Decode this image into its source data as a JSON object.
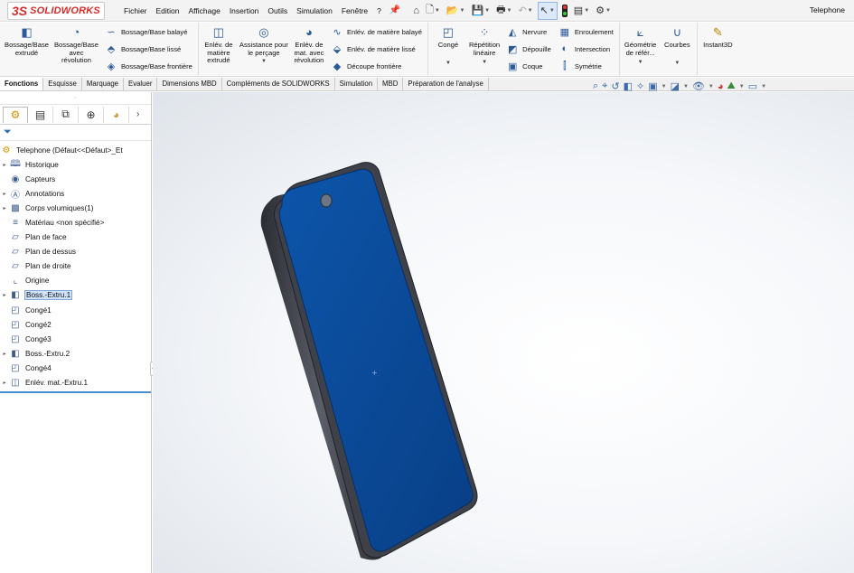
{
  "app": {
    "logo_ds": "3S",
    "logo_name": "SOLIDWORKS",
    "document_title": "Telephone"
  },
  "menu": [
    "Fichier",
    "Edition",
    "Affichage",
    "Insertion",
    "Outils",
    "Simulation",
    "Fenêtre",
    "?"
  ],
  "ribbon": {
    "extrude_boss": "Bossage/Base\nextrudé",
    "revolve_boss": "Bossage/Base\navec\nrévolution",
    "swept_boss": "Bossage/Base balayé",
    "lofted_boss": "Bossage/Base lissé",
    "boundary_boss": "Bossage/Base frontière",
    "extruded_cut": "Enlév. de\nmatière\nextrudé",
    "hole_wizard": "Assistance pour\nle perçage",
    "revolved_cut": "Enlév. de\nmat. avec\nrévolution",
    "swept_cut": "Enlév. de matière balayé",
    "lofted_cut": "Enlév. de matière lissé",
    "boundary_cut": "Découpe frontière",
    "fillet": "Congé",
    "linear_pattern": "Répétition\nlinéaire",
    "rib": "Nervure",
    "draft": "Dépouille",
    "shell": "Coque",
    "wrap": "Enroulement",
    "intersect": "Intersection",
    "mirror": "Symétrie",
    "ref_geometry": "Géométrie\nde référ...",
    "curves": "Courbes",
    "instant3d": "Instant3D"
  },
  "tabs": [
    "Fonctions",
    "Esquisse",
    "Marquage",
    "Evaluer",
    "Dimensions MBD",
    "Compléments de SOLIDWORKS",
    "Simulation",
    "MBD",
    "Préparation de l'analyse"
  ],
  "tree": {
    "root": "Telephone  (Défaut<<Défaut>_Et",
    "items": [
      {
        "label": "Historique",
        "icon": "history-icon",
        "expandable": true
      },
      {
        "label": "Capteurs",
        "icon": "sensor-icon",
        "expandable": false
      },
      {
        "label": "Annotations",
        "icon": "annotation-icon",
        "expandable": true
      },
      {
        "label": "Corps volumiques(1)",
        "icon": "solid-bodies-icon",
        "expandable": true
      },
      {
        "label": "Matériau <non spécifié>",
        "icon": "material-icon",
        "expandable": false
      },
      {
        "label": "Plan de face",
        "icon": "plane-icon",
        "expandable": false
      },
      {
        "label": "Plan de dessus",
        "icon": "plane-icon",
        "expandable": false
      },
      {
        "label": "Plan de droite",
        "icon": "plane-icon",
        "expandable": false
      },
      {
        "label": "Origine",
        "icon": "origin-icon",
        "expandable": false
      },
      {
        "label": "Boss.-Extru.1",
        "icon": "extrude-feature-icon",
        "expandable": true,
        "selected": true
      },
      {
        "label": "Congé1",
        "icon": "fillet-feature-icon",
        "expandable": false
      },
      {
        "label": "Congé2",
        "icon": "fillet-feature-icon",
        "expandable": false
      },
      {
        "label": "Congé3",
        "icon": "fillet-feature-icon",
        "expandable": false
      },
      {
        "label": "Boss.-Extru.2",
        "icon": "extrude-feature-icon",
        "expandable": true
      },
      {
        "label": "Congé4",
        "icon": "fillet-feature-icon",
        "expandable": false
      },
      {
        "label": "Enlév. mat.-Extru.1",
        "icon": "cut-feature-icon",
        "expandable": true
      }
    ]
  },
  "colors": {
    "screen": "#0b4a9c",
    "body": "#3a3d45",
    "accent": "#d72a2a"
  }
}
